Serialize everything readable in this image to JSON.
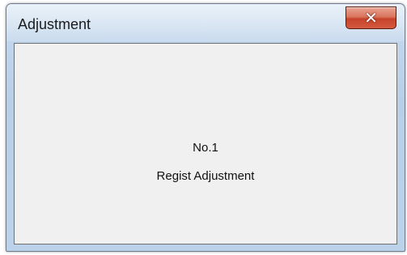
{
  "window": {
    "title": "Adjustment",
    "close_icon": "close-icon"
  },
  "content": {
    "number": "No.1",
    "description": "Regist Adjustment"
  },
  "colors": {
    "client_background": "#f0f0f0",
    "frame": "#bcd2ea",
    "close_button": "#c7432b"
  }
}
